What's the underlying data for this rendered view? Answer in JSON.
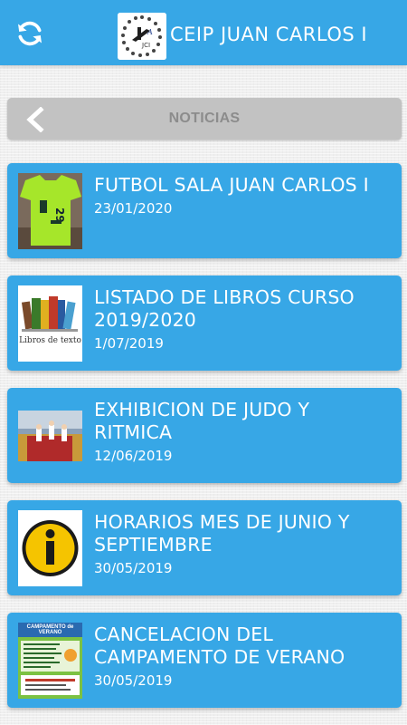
{
  "header": {
    "title": "CEIP JUAN CARLOS I",
    "refresh_icon": "refresh-icon",
    "logo_icon": "school-logo"
  },
  "section": {
    "title": "NOTICIAS",
    "back_icon": "chevron-left-icon"
  },
  "colors": {
    "primary": "#37a7e6",
    "section_bar": "#c2c2c2",
    "section_text": "#8c8c8c"
  },
  "news": [
    {
      "title": "FUTBOL SALA JUAN CARLOS I",
      "date": "23/01/2020",
      "thumb": "green-jersey-image"
    },
    {
      "title": "LISTADO DE LIBROS CURSO 2019/2020",
      "date": "1/07/2019",
      "thumb": "textbooks-image",
      "thumb_caption": "Libros de texto"
    },
    {
      "title": "EXHIBICION DE JUDO Y RITMICA",
      "date": "12/06/2019",
      "thumb": "judo-gym-image"
    },
    {
      "title": "HORARIOS MES DE JUNIO Y SEPTIEMBRE",
      "date": "30/05/2019",
      "thumb": "info-sign-image"
    },
    {
      "title": "CANCELACION DEL CAMPAMENTO DE VERANO",
      "date": "30/05/2019",
      "thumb": "summer-camp-poster-image",
      "thumb_caption": "CAMPAMENTO de VERANO"
    }
  ]
}
